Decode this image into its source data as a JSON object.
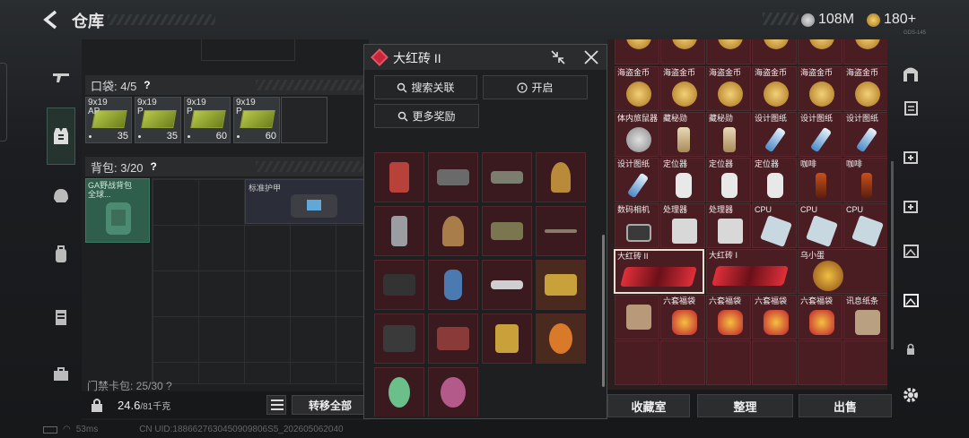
{
  "header": {
    "title": "仓库",
    "currency_a": "108M",
    "currency_b": "180+"
  },
  "nav_left": [
    "gun-icon",
    "vest-icon",
    "helmet-icon",
    "backpack-icon",
    "rig-icon",
    "case-icon"
  ],
  "pockets": {
    "label": "口袋: 4/5",
    "help": "?",
    "items": [
      {
        "name": "9x19\nAP",
        "count": "35"
      },
      {
        "name": "9x19\nP",
        "count": "35"
      },
      {
        "name": "9x19\nP",
        "count": "60"
      },
      {
        "name": "9x19\nP",
        "count": "60"
      }
    ]
  },
  "backpack": {
    "label": "背包: 3/20",
    "help": "?",
    "bag_name": "GA野战背包\n全球...",
    "armor_name": "标准护甲"
  },
  "keycase": {
    "label": "门禁卡包: 25/30 ?"
  },
  "footer": {
    "weight": "24.6",
    "weight_max": "/81千克",
    "transfer": "转移全部"
  },
  "popup": {
    "title": "大红砖 II",
    "search_btn": "搜索关联",
    "open_btn": "开启",
    "more_btn": "更多奖励"
  },
  "stash": {
    "rows": [
      [
        "海盗金币",
        "海盗金币",
        "海盗金币",
        "海盗金币",
        "海盗金币",
        "海盗金币"
      ],
      [
        "体内旅鼠器",
        "藏秘勋",
        "藏秘勋",
        "设计图纸",
        "设计图纸",
        "设计图纸"
      ],
      [
        "设计图纸",
        "定位器",
        "定位器",
        "定位器",
        "咖啡",
        "咖啡"
      ],
      [
        "数码相机",
        "处理器",
        "处理器",
        "CPU",
        "CPU",
        "CPU"
      ],
      [
        "大红砖 II",
        "",
        "大红砖 I",
        "",
        "乌小蛋",
        ""
      ],
      [
        "",
        "六套福袋",
        "六套福袋",
        "六套福袋",
        "六套福袋",
        "讯息纸条"
      ]
    ]
  },
  "bottom_tabs": {
    "vault": "收藏室",
    "sort": "整理",
    "sell": "出售"
  },
  "status": {
    "ping": "53ms",
    "uid": "CN UID:1886627630450909806S5_202605062040"
  },
  "version": "GDS-145"
}
